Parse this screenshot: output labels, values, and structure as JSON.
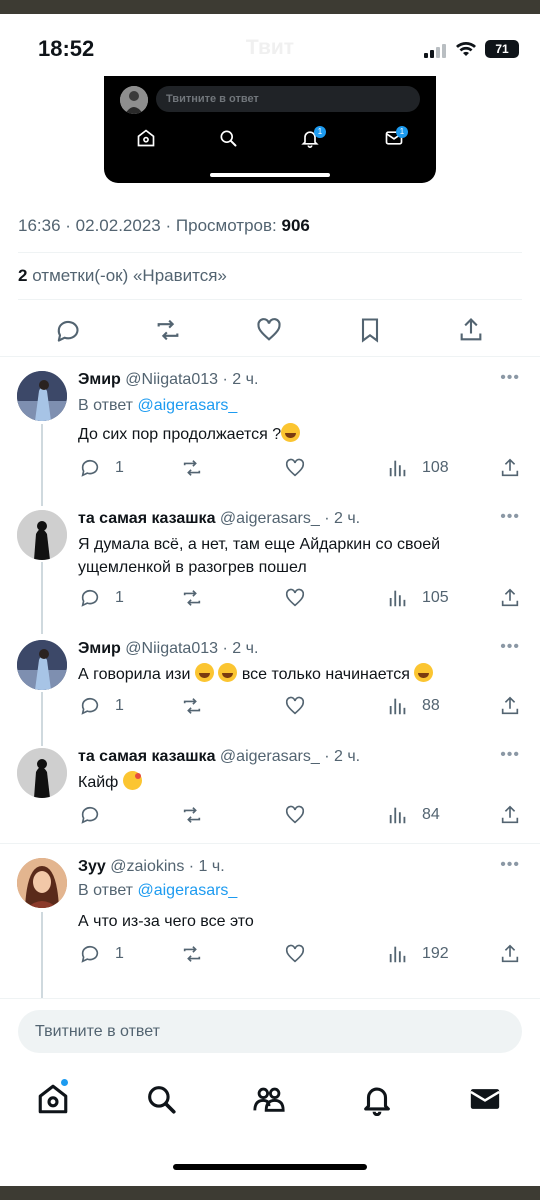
{
  "status_bar": {
    "time": "18:52",
    "title": "Твит",
    "battery": "71"
  },
  "embedded_screenshot": {
    "reply_placeholder": "Твитните в ответ",
    "notif_badge": "1",
    "messages_badge": "1"
  },
  "tweet_meta": {
    "time": "16:36",
    "date": "02.02.2023",
    "views_label": "Просмотров:",
    "views_count": "906",
    "likes_count": "2",
    "likes_label": "отметки(-ок) «Нравится»"
  },
  "replies": [
    {
      "name": "Эмир",
      "handle": "@Niigata013",
      "time": "· 2 ч.",
      "reply_to_label": "В ответ",
      "reply_to_handle": "@aigerasars_",
      "text": "До сих пор продолжается ?",
      "reply_count": "1",
      "views": "108",
      "emoji": [
        "face-with-tears-of-joy"
      ]
    },
    {
      "name": "та самая казашка",
      "handle": "@aigerasars_",
      "time": "· 2 ч.",
      "text_line1": "Я думала всё, а нет, там еще Айдаркин со своей",
      "text_line2": "ущемленкой в разогрев пошел",
      "reply_count": "1",
      "views": "105"
    },
    {
      "name": "Эмир",
      "handle": "@Niigata013",
      "time": "· 2 ч.",
      "text_a": "А говорила изи",
      "text_b": "все только начинается",
      "reply_count": "1",
      "views": "88",
      "emoji": [
        "face-with-tears-of-joy",
        "face-with-tears-of-joy",
        "face-with-tears-of-joy"
      ]
    },
    {
      "name": "та самая казашка",
      "handle": "@aigerasars_",
      "time": "· 2 ч.",
      "text": "Кайф",
      "views": "84",
      "emoji": [
        "smiling-face-with-hearts"
      ]
    },
    {
      "name": "Зуу",
      "handle": "@zaiokins",
      "time": "· 1 ч.",
      "reply_to_label": "В ответ",
      "reply_to_handle": "@aigerasars_",
      "text": "А что из-за чего все это",
      "reply_count": "1",
      "views": "192"
    }
  ],
  "more_menu": "•••",
  "composer": {
    "placeholder": "Твитните в ответ"
  },
  "tab_bar": {
    "icons": [
      "home-icon",
      "search-icon",
      "communities-icon",
      "notifications-icon",
      "messages-icon"
    ]
  },
  "colors": {
    "accent": "#1d9bf0",
    "text_primary": "#0f1419",
    "text_secondary": "#536471",
    "divider": "#eff3f4"
  }
}
